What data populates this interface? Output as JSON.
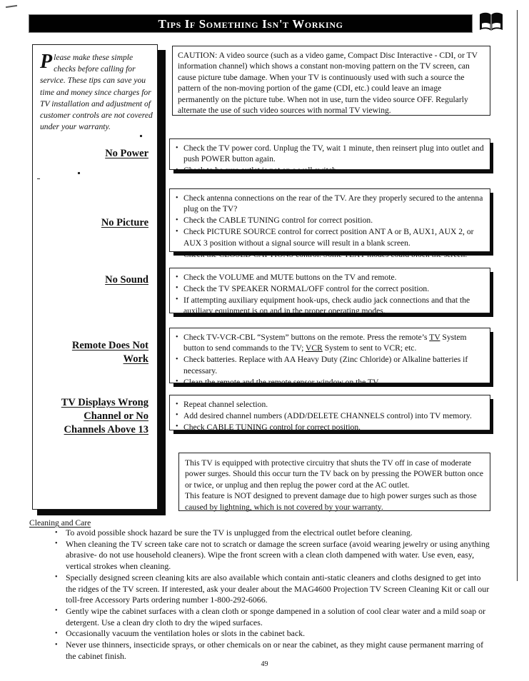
{
  "page": {
    "title": "Tips If Something Isn't Working",
    "number": "49",
    "book_icon": "open-book-icon"
  },
  "intro": {
    "dropcap": "P",
    "text": "lease make these simple checks before calling for service.  These tips can save you time and money since charges for TV installation and adjustment of customer controls are not covered under your warranty."
  },
  "caution": {
    "text": "CAUTION: A video source (such as a video game, Compact Disc Interactive - CDI, or TV information channel) which shows a constant non-moving pattern on the TV screen, can cause picture tube damage. When your TV is continuously used with such a source the pattern of the non-moving portion of the game (CDI, etc.) could leave an image permanently on the picture tube. When not in use, turn the video source OFF. Regularly alternate the use of such video sources with normal TV viewing."
  },
  "sections": [
    {
      "heading": "No Power",
      "heading_lines": [
        "No Power"
      ],
      "items": [
        "Check the TV power cord. Unplug the TV, wait 1 minute, then reinsert plug into outlet and push POWER button again.",
        "Check to be sure outlet is not on a wall switch."
      ]
    },
    {
      "heading": "No Picture",
      "heading_lines": [
        "No Picture"
      ],
      "items": [
        "Check antenna connections on the rear of the TV. Are they properly secured to the antenna plug on the TV?",
        "Check the CABLE TUNING control for correct position.",
        "Check PICTURE SOURCE control for correct position ANT A or B, AUX1, AUX 2, or AUX 3 position without a signal source will result in a blank screen.",
        "Check the CLOSED CAPTIONS control. Some TEXT modes could block the screen."
      ]
    },
    {
      "heading": "No Sound",
      "heading_lines": [
        "No Sound"
      ],
      "items": [
        "Check the VOLUME and MUTE buttons on the TV and remote.",
        "Check the TV SPEAKER NORMAL/OFF control for the correct position.",
        "If attempting auxiliary equipment hook-ups, check audio jack connections and that the auxiliary equipment is on and in the proper operating modes."
      ]
    },
    {
      "heading": "Remote Does Not Work",
      "heading_lines": [
        "Remote Does Not",
        "Work"
      ],
      "items": [
        "Check TV-VCR-CBL “System” buttons on the remote. Press the remote’s TV System button to send commands to the TV; VCR System to sent to VCR; etc.",
        "Check batteries.  Replace with AA Heavy Duty (Zinc Chloride) or Alkaline batteries if necessary.",
        "Clean the remote and the remote sensor window on the TV."
      ],
      "item_parts": [
        [
          "Check TV-VCR-CBL “System” buttons on the remote. Press the remote’s ",
          "TV",
          " System button to send commands to the TV; ",
          "VCR",
          " System to sent to VCR; etc."
        ]
      ]
    },
    {
      "heading": "TV Displays Wrong Channel or No Channels Above 13",
      "heading_lines": [
        "TV Displays Wrong",
        "Channel or No",
        "Channels Above 13"
      ],
      "items": [
        "Repeat channel selection.",
        "Add desired channel numbers (ADD/DELETE CHANNELS control) into TV memory.",
        "Check CABLE TUNING control for correct position."
      ]
    }
  ],
  "surge_note": {
    "paragraph1": "This TV is equipped with protective circuitry that shuts the TV off in case of moderate power surges. Should this occur turn the TV back on by pressing the POWER button once or twice, or unplug and then replug the power cord at the AC outlet.",
    "paragraph2": "This feature is NOT designed to prevent damage due to high power surges such as those caused by lightning, which is not covered by your warranty."
  },
  "care": {
    "title": "Cleaning and Care",
    "items": [
      "To avoid possible shock hazard be sure the TV is unplugged from the electrical outlet before cleaning.",
      "When cleaning the TV screen take care not to scratch or damage the screen surface (avoid wearing jewelry or using anything abrasive- do not use household cleaners). Wipe the front screen with a clean cloth dampened with water.  Use even, easy, vertical strokes when cleaning.",
      "Specially designed screen cleaning kits are also available which contain anti-static cleaners and cloths designed to get into the ridges of the TV screen. If interested, ask your dealer about the MAG4600 Projection TV Screen Cleaning Kit or call our toll-free Accessory Parts ordering number 1-800-292-6066.",
      "Gently wipe the cabinet surfaces with a clean cloth or sponge dampened in a solution of cool clear water and a mild soap or detergent. Use a clean dry cloth to dry the wiped surfaces.",
      "Occasionally vacuum the ventilation holes or slots in the cabinet back.",
      "Never use thinners, insecticide sprays, or other chemicals on or near the cabinet, as they might cause permanent marring of the cabinet finish."
    ]
  },
  "colors": {
    "banner_bg": "#010101",
    "banner_text": "#ffffff",
    "ink": "#111111",
    "shadow": "#0b0b0b"
  }
}
